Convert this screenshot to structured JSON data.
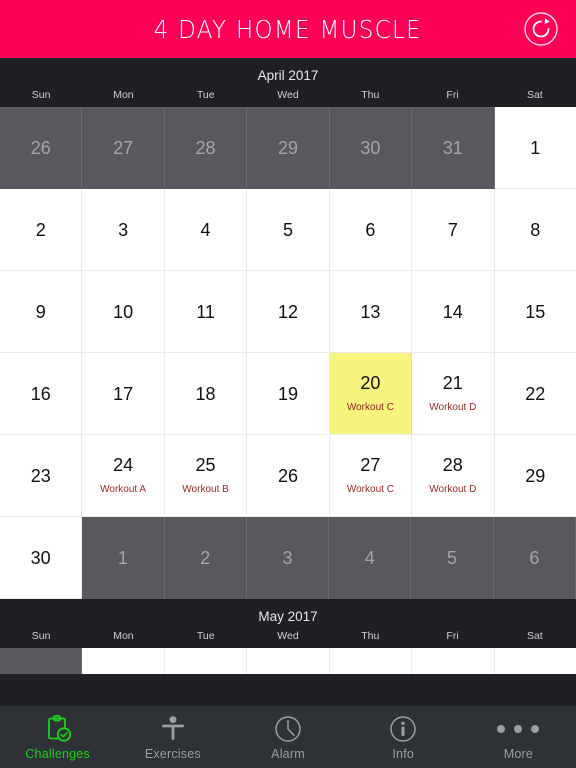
{
  "header": {
    "title": "4 DAY HOME MUSCLE",
    "refresh_icon": "refresh-icon",
    "background_color": "#ff0055",
    "text_color": "#ffffff"
  },
  "colors": {
    "accent_pink": "#ff0055",
    "today_highlight": "#f5f57e",
    "out_of_month": "#58595e",
    "workout_text": "#9c2b2b",
    "active_tab": "#19d419",
    "chrome_dark": "#1e2023",
    "tabbar": "#2e3135"
  },
  "calendar": {
    "current_month": {
      "title": "April 2017",
      "day_names": [
        "Sun",
        "Mon",
        "Tue",
        "Wed",
        "Thu",
        "Fri",
        "Sat"
      ],
      "weeks": [
        [
          {
            "day": "26",
            "out": true,
            "today": false,
            "workout": ""
          },
          {
            "day": "27",
            "out": true,
            "today": false,
            "workout": ""
          },
          {
            "day": "28",
            "out": true,
            "today": false,
            "workout": ""
          },
          {
            "day": "29",
            "out": true,
            "today": false,
            "workout": ""
          },
          {
            "day": "30",
            "out": true,
            "today": false,
            "workout": ""
          },
          {
            "day": "31",
            "out": true,
            "today": false,
            "workout": ""
          },
          {
            "day": "1",
            "out": false,
            "today": false,
            "workout": ""
          }
        ],
        [
          {
            "day": "2",
            "out": false,
            "today": false,
            "workout": ""
          },
          {
            "day": "3",
            "out": false,
            "today": false,
            "workout": ""
          },
          {
            "day": "4",
            "out": false,
            "today": false,
            "workout": ""
          },
          {
            "day": "5",
            "out": false,
            "today": false,
            "workout": ""
          },
          {
            "day": "6",
            "out": false,
            "today": false,
            "workout": ""
          },
          {
            "day": "7",
            "out": false,
            "today": false,
            "workout": ""
          },
          {
            "day": "8",
            "out": false,
            "today": false,
            "workout": ""
          }
        ],
        [
          {
            "day": "9",
            "out": false,
            "today": false,
            "workout": ""
          },
          {
            "day": "10",
            "out": false,
            "today": false,
            "workout": ""
          },
          {
            "day": "11",
            "out": false,
            "today": false,
            "workout": ""
          },
          {
            "day": "12",
            "out": false,
            "today": false,
            "workout": ""
          },
          {
            "day": "13",
            "out": false,
            "today": false,
            "workout": ""
          },
          {
            "day": "14",
            "out": false,
            "today": false,
            "workout": ""
          },
          {
            "day": "15",
            "out": false,
            "today": false,
            "workout": ""
          }
        ],
        [
          {
            "day": "16",
            "out": false,
            "today": false,
            "workout": ""
          },
          {
            "day": "17",
            "out": false,
            "today": false,
            "workout": ""
          },
          {
            "day": "18",
            "out": false,
            "today": false,
            "workout": ""
          },
          {
            "day": "19",
            "out": false,
            "today": false,
            "workout": ""
          },
          {
            "day": "20",
            "out": false,
            "today": true,
            "workout": "Workout C"
          },
          {
            "day": "21",
            "out": false,
            "today": false,
            "workout": "Workout D"
          },
          {
            "day": "22",
            "out": false,
            "today": false,
            "workout": ""
          }
        ],
        [
          {
            "day": "23",
            "out": false,
            "today": false,
            "workout": ""
          },
          {
            "day": "24",
            "out": false,
            "today": false,
            "workout": "Workout A"
          },
          {
            "day": "25",
            "out": false,
            "today": false,
            "workout": "Workout B"
          },
          {
            "day": "26",
            "out": false,
            "today": false,
            "workout": ""
          },
          {
            "day": "27",
            "out": false,
            "today": false,
            "workout": "Workout C"
          },
          {
            "day": "28",
            "out": false,
            "today": false,
            "workout": "Workout D"
          },
          {
            "day": "29",
            "out": false,
            "today": false,
            "workout": ""
          }
        ],
        [
          {
            "day": "30",
            "out": false,
            "today": false,
            "workout": ""
          },
          {
            "day": "1",
            "out": true,
            "today": false,
            "workout": ""
          },
          {
            "day": "2",
            "out": true,
            "today": false,
            "workout": ""
          },
          {
            "day": "3",
            "out": true,
            "today": false,
            "workout": ""
          },
          {
            "day": "4",
            "out": true,
            "today": false,
            "workout": ""
          },
          {
            "day": "5",
            "out": true,
            "today": false,
            "workout": ""
          },
          {
            "day": "6",
            "out": true,
            "today": false,
            "workout": ""
          }
        ]
      ]
    },
    "next_month": {
      "title": "May 2017",
      "day_names": [
        "Sun",
        "Mon",
        "Tue",
        "Wed",
        "Thu",
        "Fri",
        "Sat"
      ],
      "weeks": [
        [
          {
            "day": "",
            "out": true,
            "today": false,
            "workout": ""
          },
          {
            "day": "",
            "out": false,
            "today": false,
            "workout": ""
          },
          {
            "day": "",
            "out": false,
            "today": false,
            "workout": ""
          },
          {
            "day": "",
            "out": false,
            "today": false,
            "workout": ""
          },
          {
            "day": "",
            "out": false,
            "today": false,
            "workout": ""
          },
          {
            "day": "",
            "out": false,
            "today": false,
            "workout": ""
          },
          {
            "day": "",
            "out": false,
            "today": false,
            "workout": ""
          }
        ]
      ]
    }
  },
  "tabbar": {
    "items": [
      {
        "label": "Challenges",
        "icon": "clipboard-check-icon",
        "active": true
      },
      {
        "label": "Exercises",
        "icon": "person-figure-icon",
        "active": false
      },
      {
        "label": "Alarm",
        "icon": "clock-icon",
        "active": false
      },
      {
        "label": "Info",
        "icon": "info-circle-icon",
        "active": false
      },
      {
        "label": "More",
        "icon": "ellipsis-icon",
        "active": false
      }
    ]
  }
}
